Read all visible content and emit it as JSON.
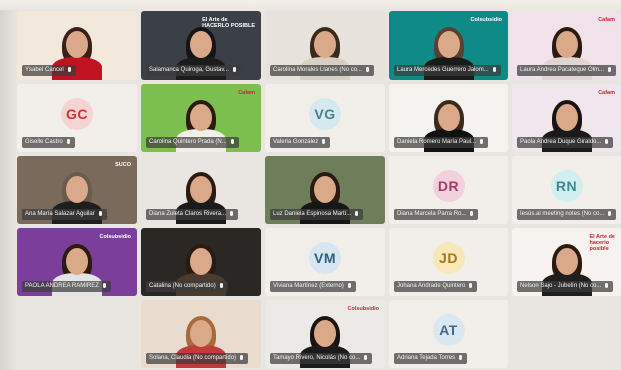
{
  "tiles": [
    {
      "name": "Ysabel Cancel",
      "initials": "",
      "row": 0,
      "col": 0,
      "kind": "video",
      "bg": "#f2e8dc",
      "shirt": "#c1121f",
      "hair": "#3a2016"
    },
    {
      "name": "Salamanca Quiroga, Gustav...",
      "initials": "",
      "row": 0,
      "col": 1,
      "kind": "video",
      "bg": "#3b3f46",
      "shirt": "#1b1b1b",
      "hair": "#151515",
      "tag": "El Arte de\nHACERLO POSIBLE"
    },
    {
      "name": "Carolina Morales Llanes (No co...",
      "initials": "",
      "row": 0,
      "col": 2,
      "kind": "video",
      "bg": "#e7e2dc",
      "shirt": "#d8cfc4",
      "hair": "#3a2a1c"
    },
    {
      "name": "Laura Mercedes Guerrero Jalom...",
      "initials": "",
      "row": 0,
      "col": 3,
      "kind": "video",
      "bg": "#0f8b87",
      "shirt": "#1a1a1a",
      "hair": "#5a4030",
      "tag": "Colsubsidio"
    },
    {
      "name": "Laura Andrea Pacateque Olm...",
      "initials": "",
      "row": 0,
      "col": 4,
      "kind": "video",
      "bg": "#f1e1e9",
      "shirt": "#e0d5d0",
      "hair": "#2a1a10",
      "tag": "Cafam"
    },
    {
      "name": "Giselle Castro",
      "initials": "GC",
      "row": 1,
      "col": 0,
      "kind": "avatar",
      "avatar_bg": "#f6d3d5",
      "avatar_fg": "#c0392b"
    },
    {
      "name": "Carolina Quintero Prada (N...",
      "initials": "",
      "row": 1,
      "col": 1,
      "kind": "video",
      "bg": "#7dbf4f",
      "shirt": "#f2efe9",
      "hair": "#2a1a10",
      "tag": "Cafam"
    },
    {
      "name": "Valeria González",
      "initials": "VG",
      "row": 1,
      "col": 2,
      "kind": "avatar",
      "avatar_bg": "#d6e9ef",
      "avatar_fg": "#4a7f93"
    },
    {
      "name": "Daniela Romero María Paul...",
      "initials": "",
      "row": 1,
      "col": 3,
      "kind": "video",
      "bg": "#f5f3f0",
      "shirt": "#111111",
      "hair": "#3a2a1c"
    },
    {
      "name": "Paola Andrea Duque Giraldo...",
      "initials": "",
      "row": 1,
      "col": 4,
      "kind": "video",
      "bg": "#efe6ee",
      "shirt": "#1a1a1a",
      "hair": "#1a1410",
      "tag": "Cafam"
    },
    {
      "name": "Ana María Salazar Aguilar",
      "initials": "",
      "row": 2,
      "col": 0,
      "kind": "video",
      "bg": "#7a6a5c",
      "shirt": "#1e1e1e",
      "hair": "#6a5a4a",
      "tag": "SUCO"
    },
    {
      "name": "Diana Zuleta Claros Rivera...",
      "initials": "",
      "row": 2,
      "col": 1,
      "kind": "video",
      "bg": "#e9e5e0",
      "shirt": "#1a1a1a",
      "hair": "#2a1a10"
    },
    {
      "name": "Luz Daniela Espinosa Martí...",
      "initials": "",
      "row": 2,
      "col": 2,
      "kind": "video",
      "bg": "#6e7e5a",
      "shirt": "#161616",
      "hair": "#2a1a10"
    },
    {
      "name": "Diana Marcela Parra Ro...",
      "initials": "DR",
      "row": 2,
      "col": 3,
      "kind": "avatar",
      "avatar_bg": "#f3d0de",
      "avatar_fg": "#a33a66"
    },
    {
      "name": "Iesús.ai meeting notes (No co...",
      "initials": "RN",
      "row": 2,
      "col": 4,
      "kind": "avatar",
      "avatar_bg": "#d1eef0",
      "avatar_fg": "#3d8a92"
    },
    {
      "name": "PAOLA ANDREA RAMIREZ",
      "initials": "",
      "row": 3,
      "col": 0,
      "kind": "video",
      "bg": "#7b3e9b",
      "shirt": "#e4e4e4",
      "hair": "#2a1a10",
      "tag": "Colsubsidio"
    },
    {
      "name": "Catalina (No compartido)",
      "initials": "",
      "row": 3,
      "col": 1,
      "kind": "video",
      "bg": "#2b2724",
      "shirt": "#4a3a30",
      "hair": "#2a1a10"
    },
    {
      "name": "Viviana Martínez (Externo)",
      "initials": "VM",
      "row": 3,
      "col": 2,
      "kind": "avatar",
      "avatar_bg": "#d7e6f0",
      "avatar_fg": "#2f5d7c"
    },
    {
      "name": "Johana Andrade Quintero",
      "initials": "JD",
      "row": 3,
      "col": 3,
      "kind": "avatar",
      "avatar_bg": "#f8e7b8",
      "avatar_fg": "#a2761d"
    },
    {
      "name": "Nelson Sajo - Jubelín (No co...",
      "initials": "",
      "row": 3,
      "col": 4,
      "kind": "video",
      "bg": "#f5f2f0",
      "shirt": "#1e1e1e",
      "hair": "#2a1a10",
      "tag": "El Arte de\nhacerlo\nposible"
    },
    {
      "name": "Solana, Claudia (No compartido)",
      "initials": "",
      "row": 4,
      "col": 1,
      "kind": "video",
      "bg": "#e9dccf",
      "shirt": "#c23b3b",
      "hair": "#a86a3a"
    },
    {
      "name": "Tamayo Rivero, Nicolás (No co...",
      "initials": "",
      "row": 4,
      "col": 2,
      "kind": "video",
      "bg": "#eceae7",
      "shirt": "#1a1a1a",
      "hair": "#1a1410",
      "tag": "Colsubsidio"
    },
    {
      "name": "Adriana Tejada Torres",
      "initials": "AT",
      "row": 4,
      "col": 3,
      "kind": "avatar",
      "avatar_bg": "#dce8f1",
      "avatar_fg": "#3f6b8e"
    }
  ],
  "icons": {
    "mic": "microphone-icon",
    "more": "more-options-icon"
  }
}
